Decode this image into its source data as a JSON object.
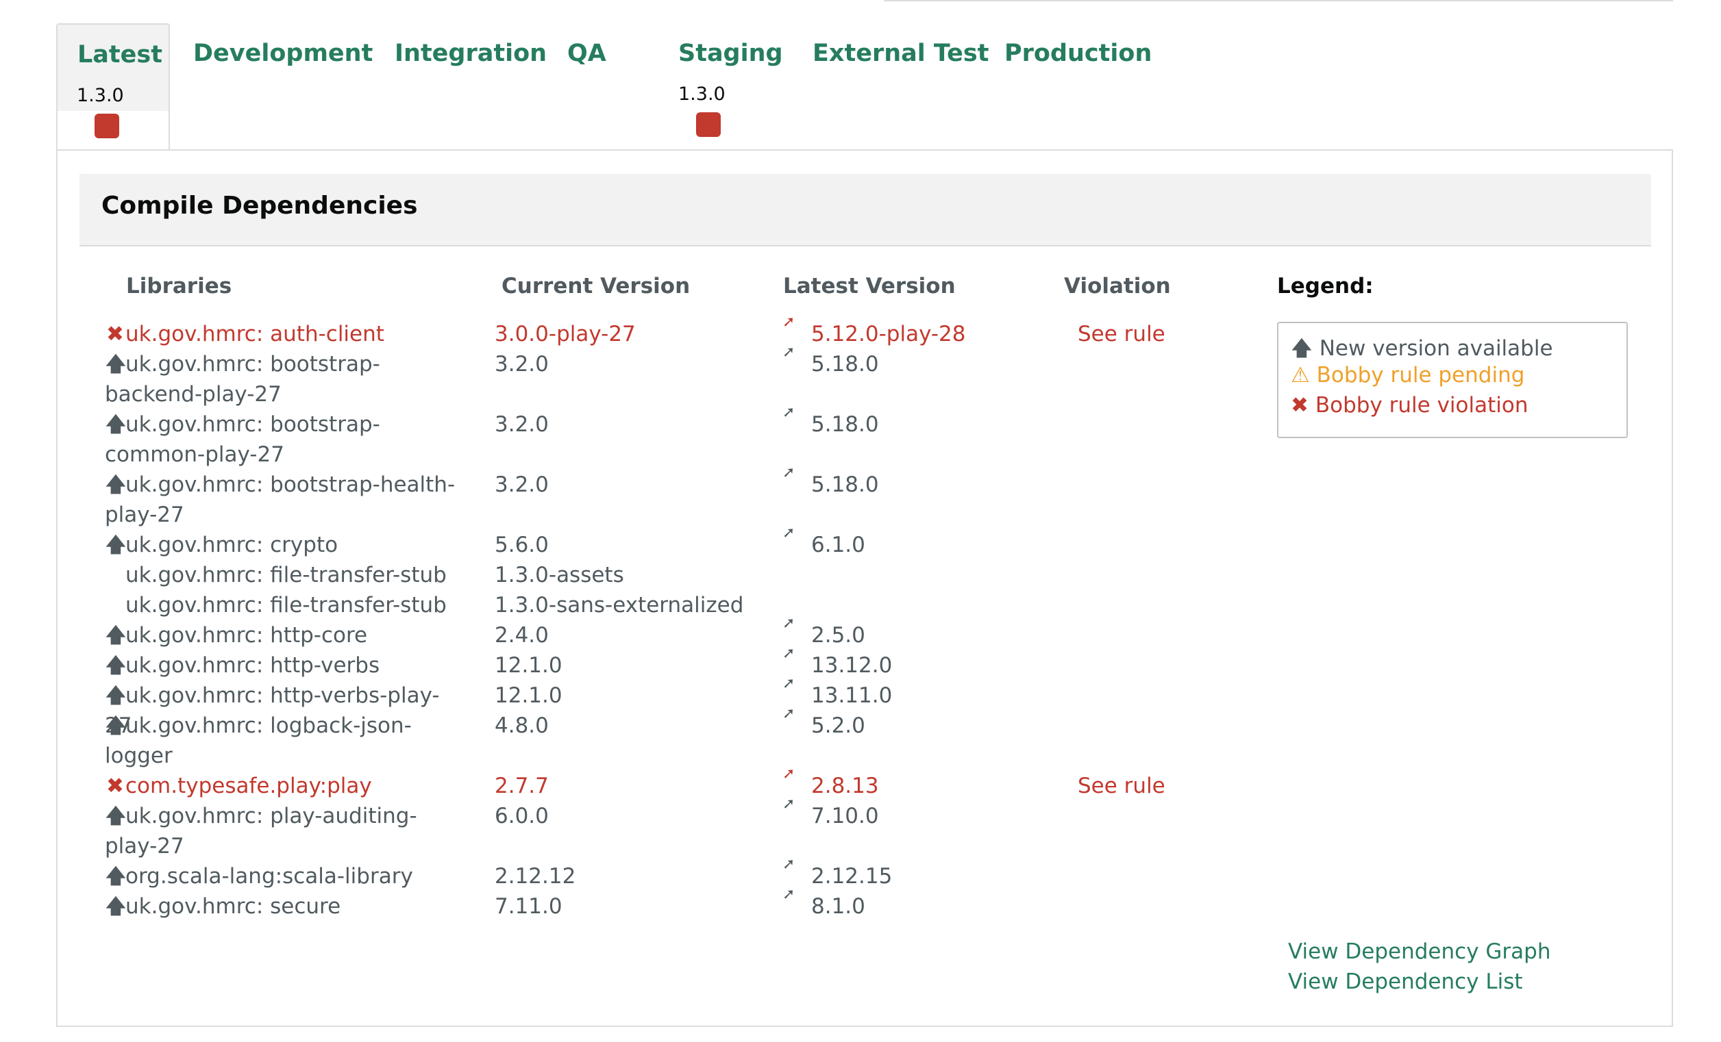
{
  "tabs": [
    {
      "label": "Latest",
      "version": "1.3.0",
      "active": true,
      "has_status": true
    },
    {
      "label": "Development",
      "version": "",
      "active": false,
      "has_status": false
    },
    {
      "label": "Integration",
      "version": "",
      "active": false,
      "has_status": false
    },
    {
      "label": "QA",
      "version": "",
      "active": false,
      "has_status": false
    },
    {
      "label": "Staging",
      "version": "1.3.0",
      "active": false,
      "has_status": true
    },
    {
      "label": "External Test",
      "version": "",
      "active": false,
      "has_status": false
    },
    {
      "label": "Production",
      "version": "",
      "active": false,
      "has_status": false
    }
  ],
  "panel": {
    "title": "Compile Dependencies",
    "columns": [
      "Libraries",
      "Current Version",
      "Latest Version",
      "Violation"
    ]
  },
  "dependencies": [
    {
      "status": "violation",
      "library": "uk.gov.hmrc: auth-client",
      "current": "3.0.0-play-27",
      "latest": "5.12.0-play-28",
      "violation": "See rule"
    },
    {
      "status": "outdated",
      "library": "uk.gov.hmrc: bootstrap-backend-play-27",
      "current": "3.2.0",
      "latest": "5.18.0",
      "violation": ""
    },
    {
      "status": "outdated",
      "library": "uk.gov.hmrc: bootstrap-common-play-27",
      "current": "3.2.0",
      "latest": "5.18.0",
      "violation": ""
    },
    {
      "status": "outdated",
      "library": "uk.gov.hmrc: bootstrap-health-play-27",
      "current": "3.2.0",
      "latest": "5.18.0",
      "violation": ""
    },
    {
      "status": "outdated",
      "library": "uk.gov.hmrc: crypto",
      "current": "5.6.0",
      "latest": "6.1.0",
      "violation": ""
    },
    {
      "status": "ok",
      "library": "uk.gov.hmrc: file-transfer-stub",
      "current": "1.3.0-assets",
      "latest": "",
      "violation": ""
    },
    {
      "status": "ok",
      "library": "uk.gov.hmrc: file-transfer-stub",
      "current": "1.3.0-sans-externalized",
      "latest": "",
      "violation": ""
    },
    {
      "status": "outdated",
      "library": "uk.gov.hmrc: http-core",
      "current": "2.4.0",
      "latest": "2.5.0",
      "violation": ""
    },
    {
      "status": "outdated",
      "library": "uk.gov.hmrc: http-verbs",
      "current": "12.1.0",
      "latest": "13.12.0",
      "violation": ""
    },
    {
      "status": "outdated",
      "library": "uk.gov.hmrc: http-verbs-play-27",
      "current": "12.1.0",
      "latest": "13.11.0",
      "violation": ""
    },
    {
      "status": "outdated",
      "library": "uk.gov.hmrc: logback-json-logger",
      "current": "4.8.0",
      "latest": "5.2.0",
      "violation": ""
    },
    {
      "status": "violation",
      "library": "com.typesafe.play:play",
      "current": "2.7.7",
      "latest": "2.8.13",
      "violation": "See rule"
    },
    {
      "status": "outdated",
      "library": "uk.gov.hmrc: play-auditing-play-27",
      "current": "6.0.0",
      "latest": "7.10.0",
      "violation": ""
    },
    {
      "status": "outdated",
      "library": "org.scala-lang:scala-library",
      "current": "2.12.12",
      "latest": "2.12.15",
      "violation": ""
    },
    {
      "status": "outdated",
      "library": "uk.gov.hmrc: secure",
      "current": "7.11.0",
      "latest": "8.1.0",
      "violation": ""
    }
  ],
  "legend": {
    "title": "Legend:",
    "new_version": "New version available",
    "pending": "Bobby rule pending",
    "violation": "Bobby rule violation"
  },
  "links": {
    "graph": "View Dependency Graph",
    "list": "View Dependency List"
  },
  "colors": {
    "link_green": "#267d5e",
    "violation_red": "#c2392e",
    "pending_amber": "#f0a02a",
    "muted_grey": "#505a5f"
  },
  "icons": {
    "outdated": "arrow-up-icon",
    "violation": "cross-icon",
    "pending": "warning-icon",
    "latest_arrow": "arrow-up-right-icon"
  }
}
